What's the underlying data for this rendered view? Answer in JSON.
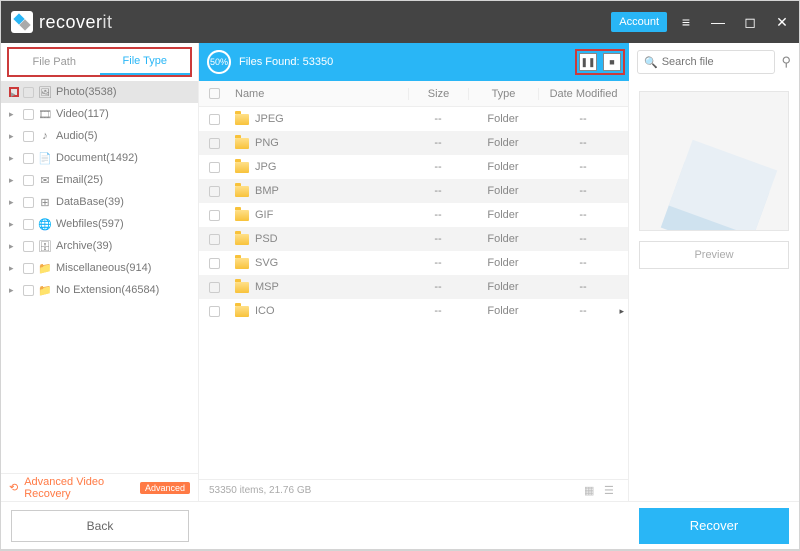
{
  "title": {
    "brand1": "recover",
    "brand2": "it",
    "account": "Account"
  },
  "sidebar": {
    "tabs": {
      "path": "File Path",
      "type": "File Type"
    },
    "items": [
      {
        "icon": "🖼",
        "label": "Photo(3538)",
        "selected": true
      },
      {
        "icon": "🎞",
        "label": "Video(117)"
      },
      {
        "icon": "♪",
        "label": "Audio(5)"
      },
      {
        "icon": "📄",
        "label": "Document(1492)"
      },
      {
        "icon": "✉",
        "label": "Email(25)"
      },
      {
        "icon": "⊞",
        "label": "DataBase(39)"
      },
      {
        "icon": "🌐",
        "label": "Webfiles(597)"
      },
      {
        "icon": "🗄",
        "label": "Archive(39)"
      },
      {
        "icon": "📁",
        "label": "Miscellaneous(914)"
      },
      {
        "icon": "📁",
        "label": "No Extension(46584)"
      }
    ],
    "adv": {
      "label": "Advanced Video Recovery",
      "badge": "Advanced"
    }
  },
  "scan": {
    "progress": "50%",
    "found_label": "Files Found:",
    "found_count": "53350",
    "search_placeholder": "Search file"
  },
  "table": {
    "headers": {
      "name": "Name",
      "size": "Size",
      "type": "Type",
      "date": "Date Modified"
    },
    "rows": [
      {
        "name": "JPEG",
        "size": "--",
        "type": "Folder",
        "date": "--"
      },
      {
        "name": "PNG",
        "size": "--",
        "type": "Folder",
        "date": "--"
      },
      {
        "name": "JPG",
        "size": "--",
        "type": "Folder",
        "date": "--"
      },
      {
        "name": "BMP",
        "size": "--",
        "type": "Folder",
        "date": "--"
      },
      {
        "name": "GIF",
        "size": "--",
        "type": "Folder",
        "date": "--"
      },
      {
        "name": "PSD",
        "size": "--",
        "type": "Folder",
        "date": "--"
      },
      {
        "name": "SVG",
        "size": "--",
        "type": "Folder",
        "date": "--"
      },
      {
        "name": "MSP",
        "size": "--",
        "type": "Folder",
        "date": "--"
      },
      {
        "name": "ICO",
        "size": "--",
        "type": "Folder",
        "date": "--"
      }
    ]
  },
  "preview": {
    "label": "Preview"
  },
  "status": {
    "text": "53350 items, 21.76  GB"
  },
  "footer": {
    "back": "Back",
    "recover": "Recover"
  }
}
